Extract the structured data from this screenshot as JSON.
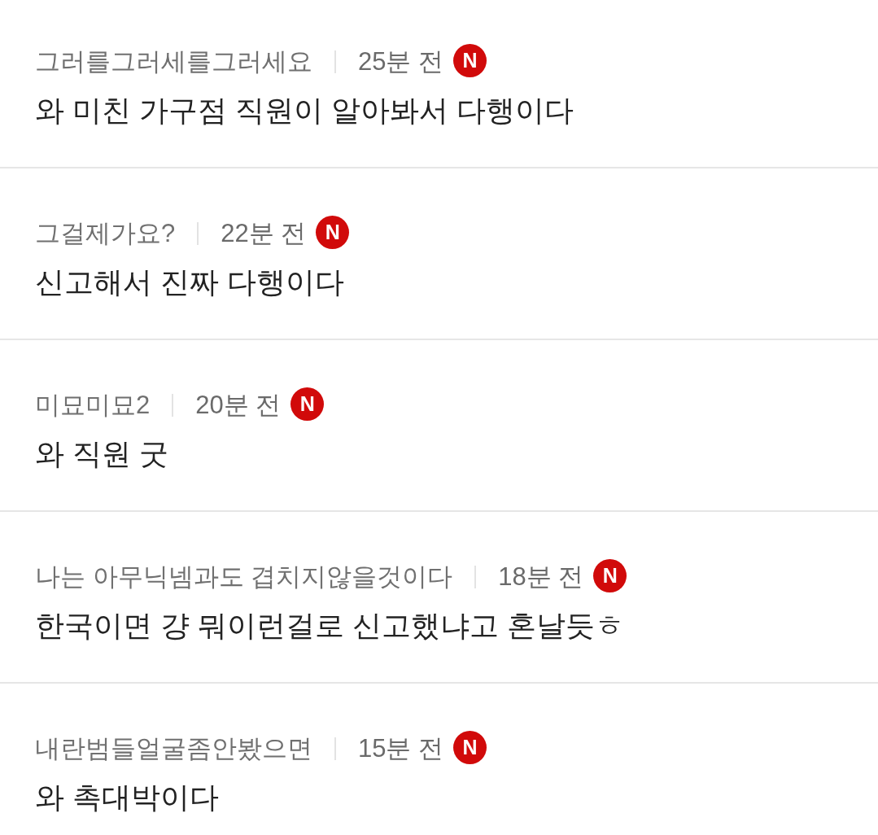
{
  "comments": [
    {
      "author": "그러를그러세를그러세요",
      "time": "25분 전",
      "badge": "N",
      "text": "와 미친 가구점 직원이 알아봐서 다행이다"
    },
    {
      "author": "그걸제가요?",
      "time": "22분 전",
      "badge": "N",
      "text": "신고해서 진짜 다행이다"
    },
    {
      "author": "미묘미묘2",
      "time": "20분 전",
      "badge": "N",
      "text": "와 직원 굿"
    },
    {
      "author": "나는 아무닉넴과도 겹치지않을것이다",
      "time": "18분 전",
      "badge": "N",
      "text": "한국이면 걍 뭐이런걸로 신고했냐고 혼날듯ㅎ"
    },
    {
      "author": "내란범들얼굴좀안봤으면",
      "time": "15분 전",
      "badge": "N",
      "text": "와 촉대박이다"
    }
  ]
}
